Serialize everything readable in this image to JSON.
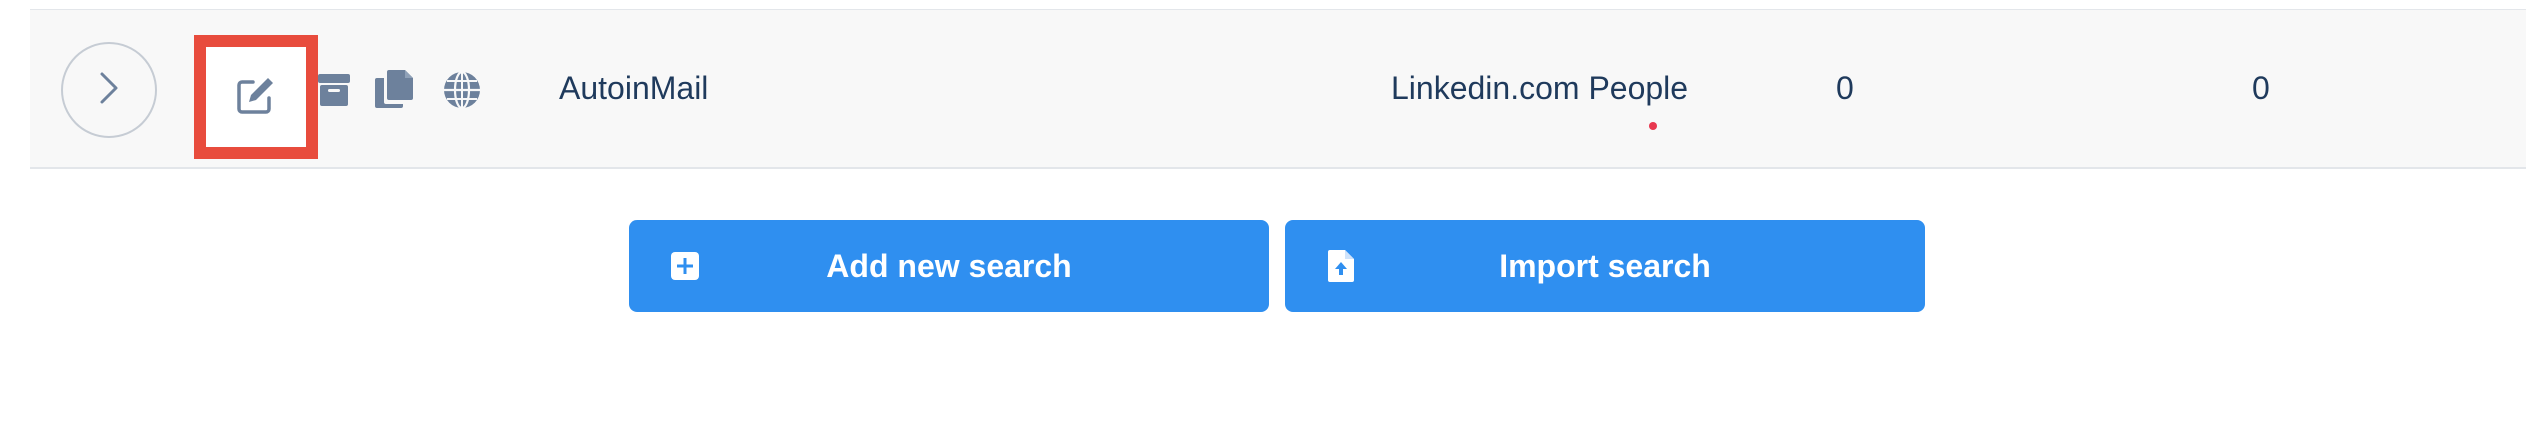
{
  "row": {
    "icons": {
      "expand": "chevron-right-icon",
      "edit": "edit-icon",
      "archive": "archive-icon",
      "duplicate": "copy-icon",
      "web": "globe-icon"
    },
    "search_name": "AutoinMail",
    "source": "Linkedin.com People",
    "count_1": "0",
    "count_2": "0"
  },
  "buttons": {
    "add_new_search": "Add new search",
    "import_search": "Import search"
  },
  "colors": {
    "primary": "#2f8ff0",
    "highlight": "#e84c3d",
    "text": "#1f3a5c",
    "icon": "#6d819c",
    "indicator_dot": "#e8384f"
  }
}
